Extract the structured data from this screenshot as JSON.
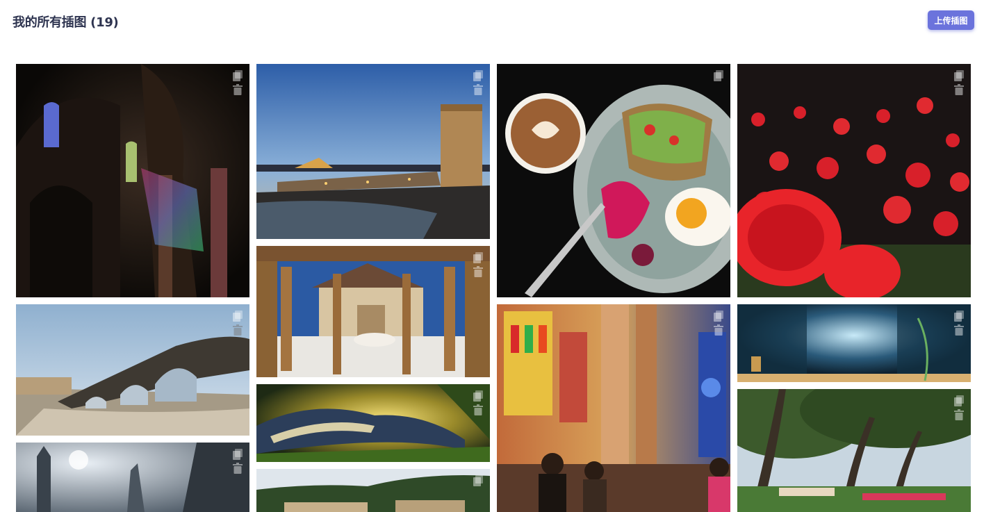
{
  "header": {
    "title": "我的所有插图 (19)",
    "upload_label": "上传插图"
  },
  "icons": {
    "copy": "copy-icon",
    "delete": "trash-icon"
  },
  "colors": {
    "accent": "#6b73dc",
    "title": "#2e3450"
  },
  "images": [
    {
      "id": "cathedral-interior"
    },
    {
      "id": "bridge-dusk"
    },
    {
      "id": "coffee-breakfast"
    },
    {
      "id": "red-flowers"
    },
    {
      "id": "stone-bridge-day"
    },
    {
      "id": "alhambra-courtyard"
    },
    {
      "id": "cathedral-stained-glass"
    },
    {
      "id": "library-fantasy"
    },
    {
      "id": "open-book-fantasy"
    },
    {
      "id": "garden-trees"
    },
    {
      "id": "foggy-ruins"
    },
    {
      "id": "hilltop-walls"
    }
  ]
}
